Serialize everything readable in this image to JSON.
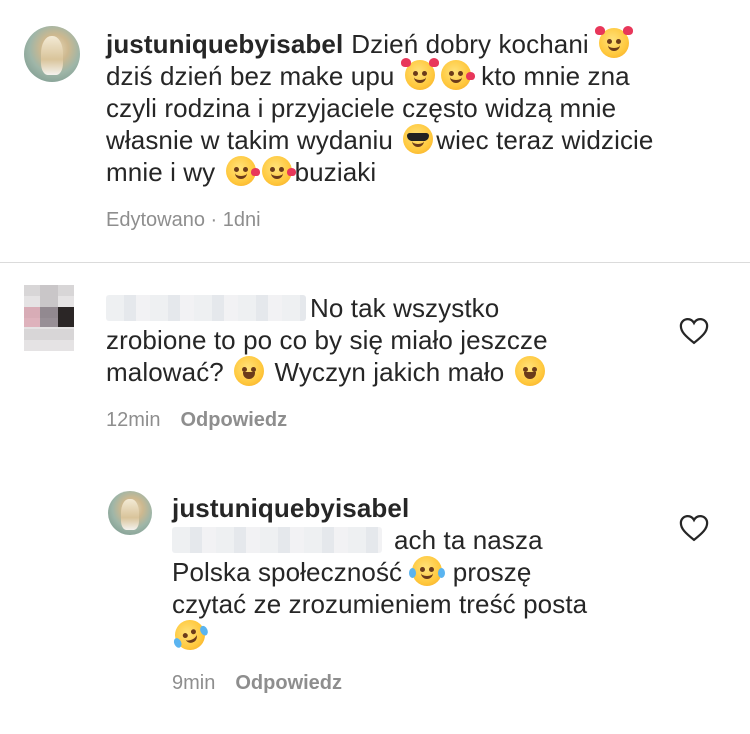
{
  "caption": {
    "username": "justuniquebyisabel",
    "line1_text": "Dzień dobry kochani",
    "line2_a": "dziś dzień bez make upu",
    "line2_b": "kto mnie zna",
    "line3": "czyli rodzina i przyjaciele często widzą mnie",
    "line4_a": "własnie w takim wydaniu",
    "line4_b": "wiec teraz widzicie",
    "line5_a": "mnie i wy",
    "line5_b": "buziaki",
    "meta": "Edytowano · 1dni"
  },
  "comment": {
    "line1": "No tak wszystko",
    "line2": "zrobione to po co by się miało jeszcze",
    "line3_a": "malować?",
    "line3_b": "Wyczyn jakich mało",
    "time": "12min",
    "reply_label": "Odpowiedz"
  },
  "reply": {
    "username": "justuniquebyisabel",
    "line1": "ach ta nasza",
    "line2_a": "Polska społeczność",
    "line2_b": "proszę",
    "line3": "czytać ze zrozumieniem treść posta",
    "time": "9min",
    "reply_label": "Odpowiedz"
  },
  "icons": {
    "like": "heart-outline-icon",
    "emoji_love": "smiling-face-with-hearts",
    "emoji_kiss": "face-blowing-kiss",
    "emoji_sunglasses": "smiling-face-with-sunglasses",
    "emoji_laugh": "grinning-squinting-face",
    "emoji_tears": "face-with-tears-of-joy",
    "emoji_rofl": "rolling-on-the-floor-laughing"
  },
  "colors": {
    "text": "#262626",
    "secondary": "#8e8e8e",
    "divider": "#dbdbdb"
  }
}
